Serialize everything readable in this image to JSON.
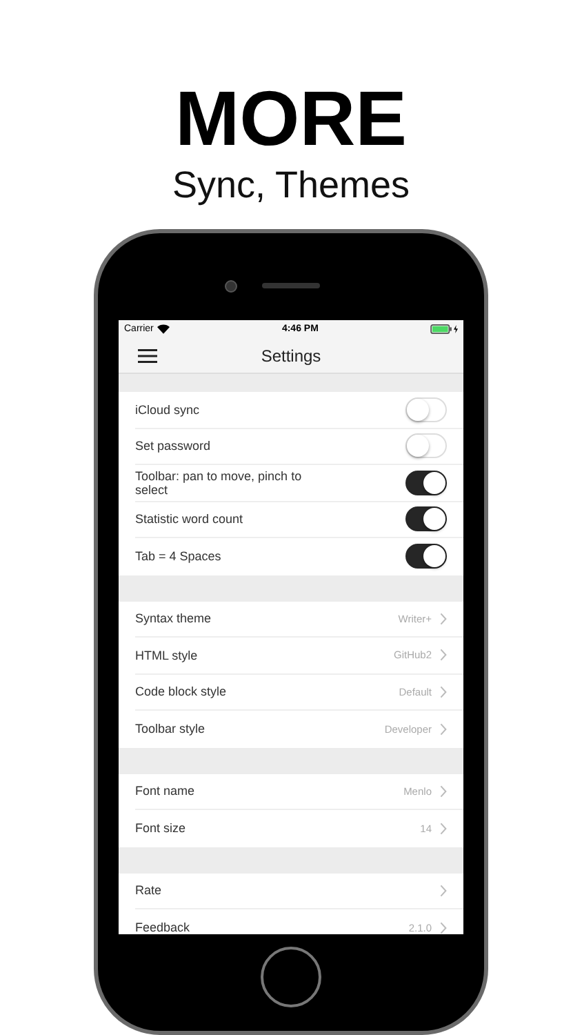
{
  "headline": "MORE",
  "subtitle": "Sync, Themes",
  "status_bar": {
    "carrier": "Carrier",
    "time": "4:46 PM"
  },
  "nav": {
    "title": "Settings"
  },
  "sections": [
    {
      "rows": [
        {
          "kind": "toggle",
          "label": "iCloud sync",
          "on": false
        },
        {
          "kind": "toggle",
          "label": "Set password",
          "on": false
        },
        {
          "kind": "toggle",
          "label": "Toolbar: pan to move, pinch to select",
          "on": true
        },
        {
          "kind": "toggle",
          "label": "Statistic word count",
          "on": true
        },
        {
          "kind": "toggle",
          "label": "Tab = 4 Spaces",
          "on": true
        }
      ]
    },
    {
      "rows": [
        {
          "kind": "link",
          "label": "Syntax theme",
          "value": "Writer+"
        },
        {
          "kind": "link",
          "label": "HTML style",
          "value": "GitHub2"
        },
        {
          "kind": "link",
          "label": "Code block style",
          "value": "Default"
        },
        {
          "kind": "link",
          "label": "Toolbar style",
          "value": "Developer"
        }
      ]
    },
    {
      "rows": [
        {
          "kind": "link",
          "label": "Font name",
          "value": "Menlo"
        },
        {
          "kind": "link",
          "label": "Font size",
          "value": "14"
        }
      ]
    },
    {
      "rows": [
        {
          "kind": "link",
          "label": "Rate"
        },
        {
          "kind": "link",
          "label": "Feedback",
          "value": "2.1.0"
        }
      ]
    }
  ]
}
